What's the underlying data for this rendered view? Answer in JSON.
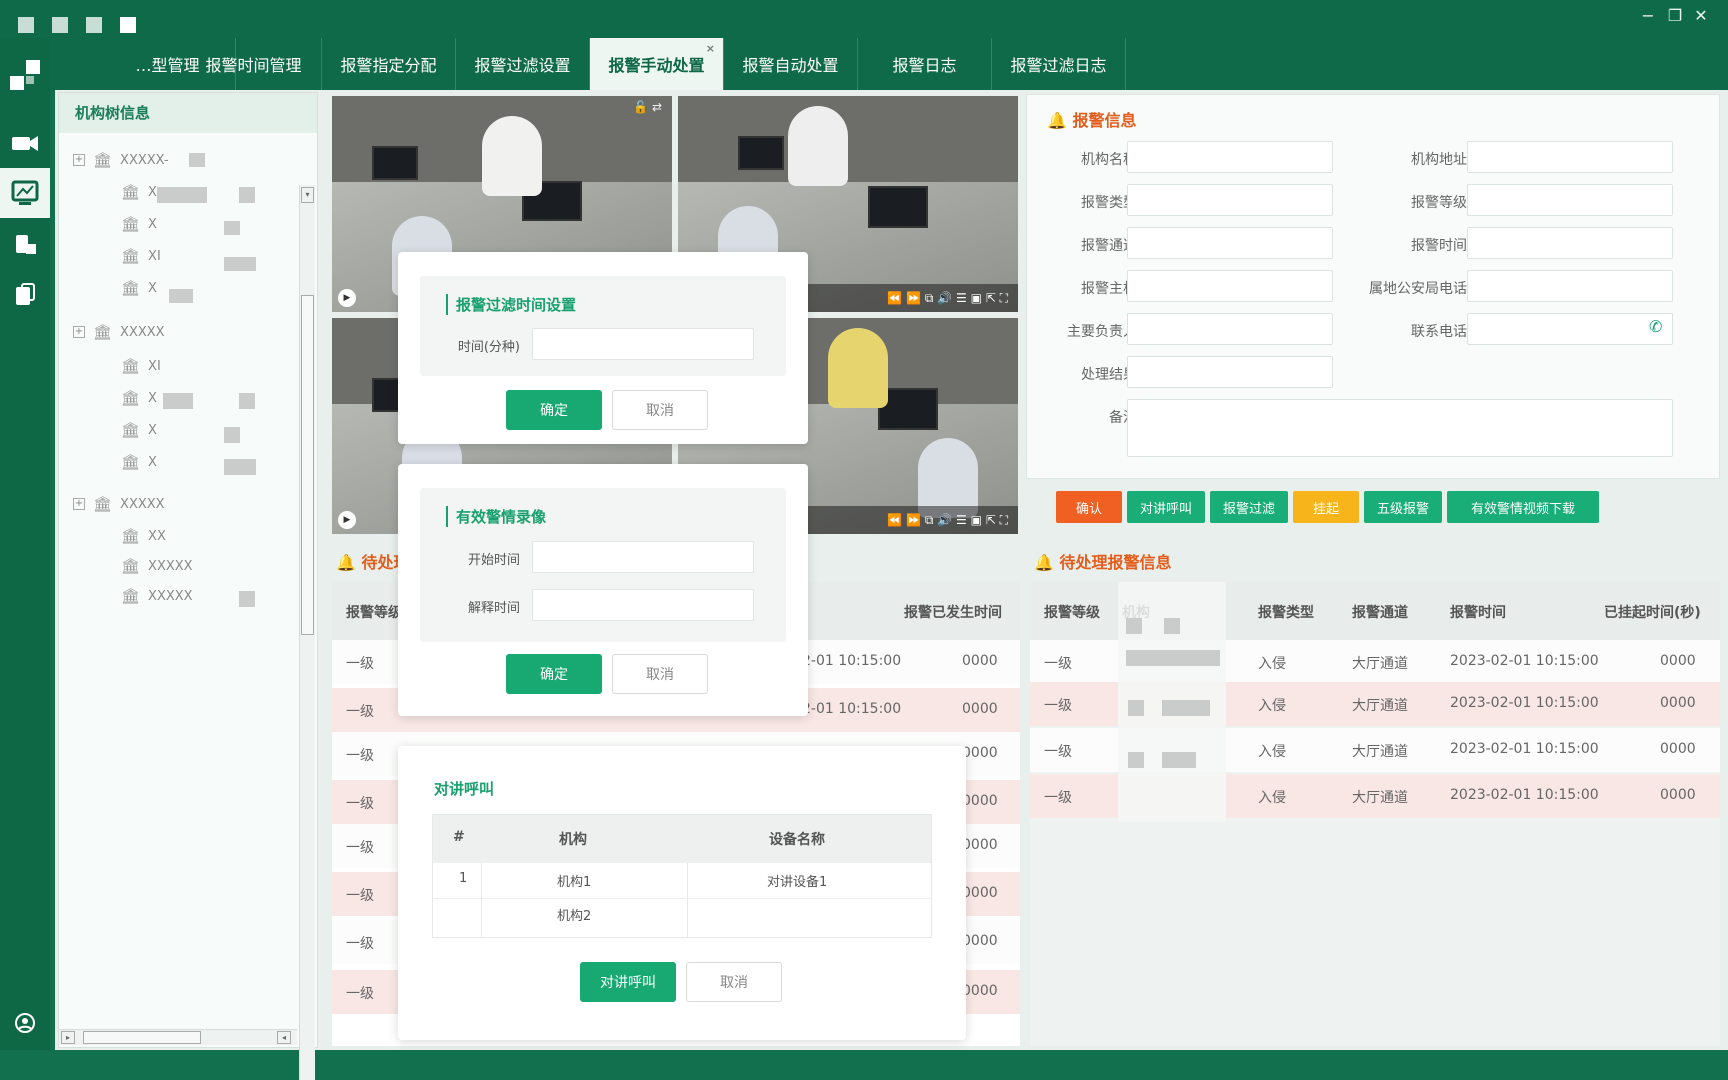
{
  "window": {
    "minimize": "−",
    "restore": "❐",
    "close": "✕"
  },
  "tabs": [
    {
      "label": "…型管理"
    },
    {
      "label": "报警时间管理"
    },
    {
      "label": "报警指定分配"
    },
    {
      "label": "报警过滤设置"
    },
    {
      "label": "报警手动处置",
      "active": true,
      "close": "×"
    },
    {
      "label": "报警自动处置"
    },
    {
      "label": "报警日志"
    },
    {
      "label": "报警过滤日志"
    }
  ],
  "tree": {
    "title": "机构树信息",
    "groups": [
      {
        "label": "XXXXX-",
        "children": [
          "X",
          "X",
          "XI",
          "X"
        ]
      },
      {
        "label": "XXXXX",
        "children": [
          "XI",
          "X",
          "X",
          "X"
        ]
      },
      {
        "label": "XXXXX",
        "children": [
          "XX",
          "XXXXX",
          "XXXXX"
        ]
      }
    ]
  },
  "alarm_info": {
    "title": "报警信息",
    "fields_left": [
      {
        "label": "机构名称",
        "value": ""
      },
      {
        "label": "报警类型",
        "value": ""
      },
      {
        "label": "报警通道",
        "value": ""
      },
      {
        "label": "报警主机",
        "value": ""
      },
      {
        "label": "主要负责人",
        "value": ""
      },
      {
        "label": "处理结果",
        "value": ""
      }
    ],
    "fields_right": [
      {
        "label": "机构地址",
        "value": ""
      },
      {
        "label": "报警等级",
        "value": ""
      },
      {
        "label": "报警时间",
        "value": ""
      },
      {
        "label": "属地公安局电话",
        "value": ""
      },
      {
        "label": "联系电话",
        "value": ""
      }
    ],
    "note_label": "备注",
    "buttons": [
      "确认",
      "对讲呼叫",
      "报警过滤",
      "挂起",
      "五级报警",
      "有效警情视频下载"
    ],
    "colors": {
      "confirm": "#f06022",
      "green": "#19ad78",
      "suspend": "#f7b51b"
    }
  },
  "left_table": {
    "title": "待处理",
    "headers": [
      "报警等级",
      "报警已发生时间"
    ],
    "rows": [
      {
        "level": "一级",
        "time": "2-01  10:15:00",
        "elapsed": "0000"
      },
      {
        "level": "一级",
        "time": "2-01  10:15:00",
        "elapsed": "0000"
      },
      {
        "level": "一级",
        "time": "",
        "elapsed": "0000"
      },
      {
        "level": "一级",
        "time": "",
        "elapsed": "0000"
      },
      {
        "level": "一级",
        "time": "",
        "elapsed": "0000"
      },
      {
        "level": "一级",
        "time": "",
        "elapsed": "0000"
      },
      {
        "level": "一级",
        "time": "",
        "elapsed": "0000"
      },
      {
        "level": "一级",
        "time": "",
        "elapsed": "0000"
      }
    ]
  },
  "right_table": {
    "title": "待处理报警信息",
    "headers": [
      "报警等级",
      "机构",
      "报警类型",
      "报警通道",
      "报警时间",
      "已挂起时间(秒)"
    ],
    "rows": [
      {
        "level": "一级",
        "org": "",
        "type": "入侵",
        "channel": "大厅通道",
        "time": "2023-02-01  10:15:00",
        "elapsed": "0000"
      },
      {
        "level": "一级",
        "org": "",
        "type": "入侵",
        "channel": "大厅通道",
        "time": "2023-02-01  10:15:00",
        "elapsed": "0000"
      },
      {
        "level": "一级",
        "org": "",
        "type": "入侵",
        "channel": "大厅通道",
        "time": "2023-02-01  10:15:00",
        "elapsed": "0000"
      },
      {
        "level": "一级",
        "org": "",
        "type": "入侵",
        "channel": "大厅通道",
        "time": "2023-02-01  10:15:00",
        "elapsed": "0000"
      }
    ]
  },
  "dialog_filter": {
    "title": "报警过滤时间设置",
    "label": "时间(分种)",
    "value": "",
    "ok": "确定",
    "cancel": "取消"
  },
  "dialog_record": {
    "title": "有效警情录像",
    "start_label": "开始时间",
    "end_label": "解释时间",
    "ok": "确定",
    "cancel": "取消"
  },
  "dialog_intercom": {
    "title": "对讲呼叫",
    "headers": [
      "#",
      "机构",
      "设备名称"
    ],
    "rows": [
      {
        "idx": "1",
        "org": "机构1",
        "device": "对讲设备1"
      },
      {
        "idx": "",
        "org": "机构2",
        "device": ""
      }
    ],
    "ok": "对讲呼叫",
    "cancel": "取消"
  }
}
